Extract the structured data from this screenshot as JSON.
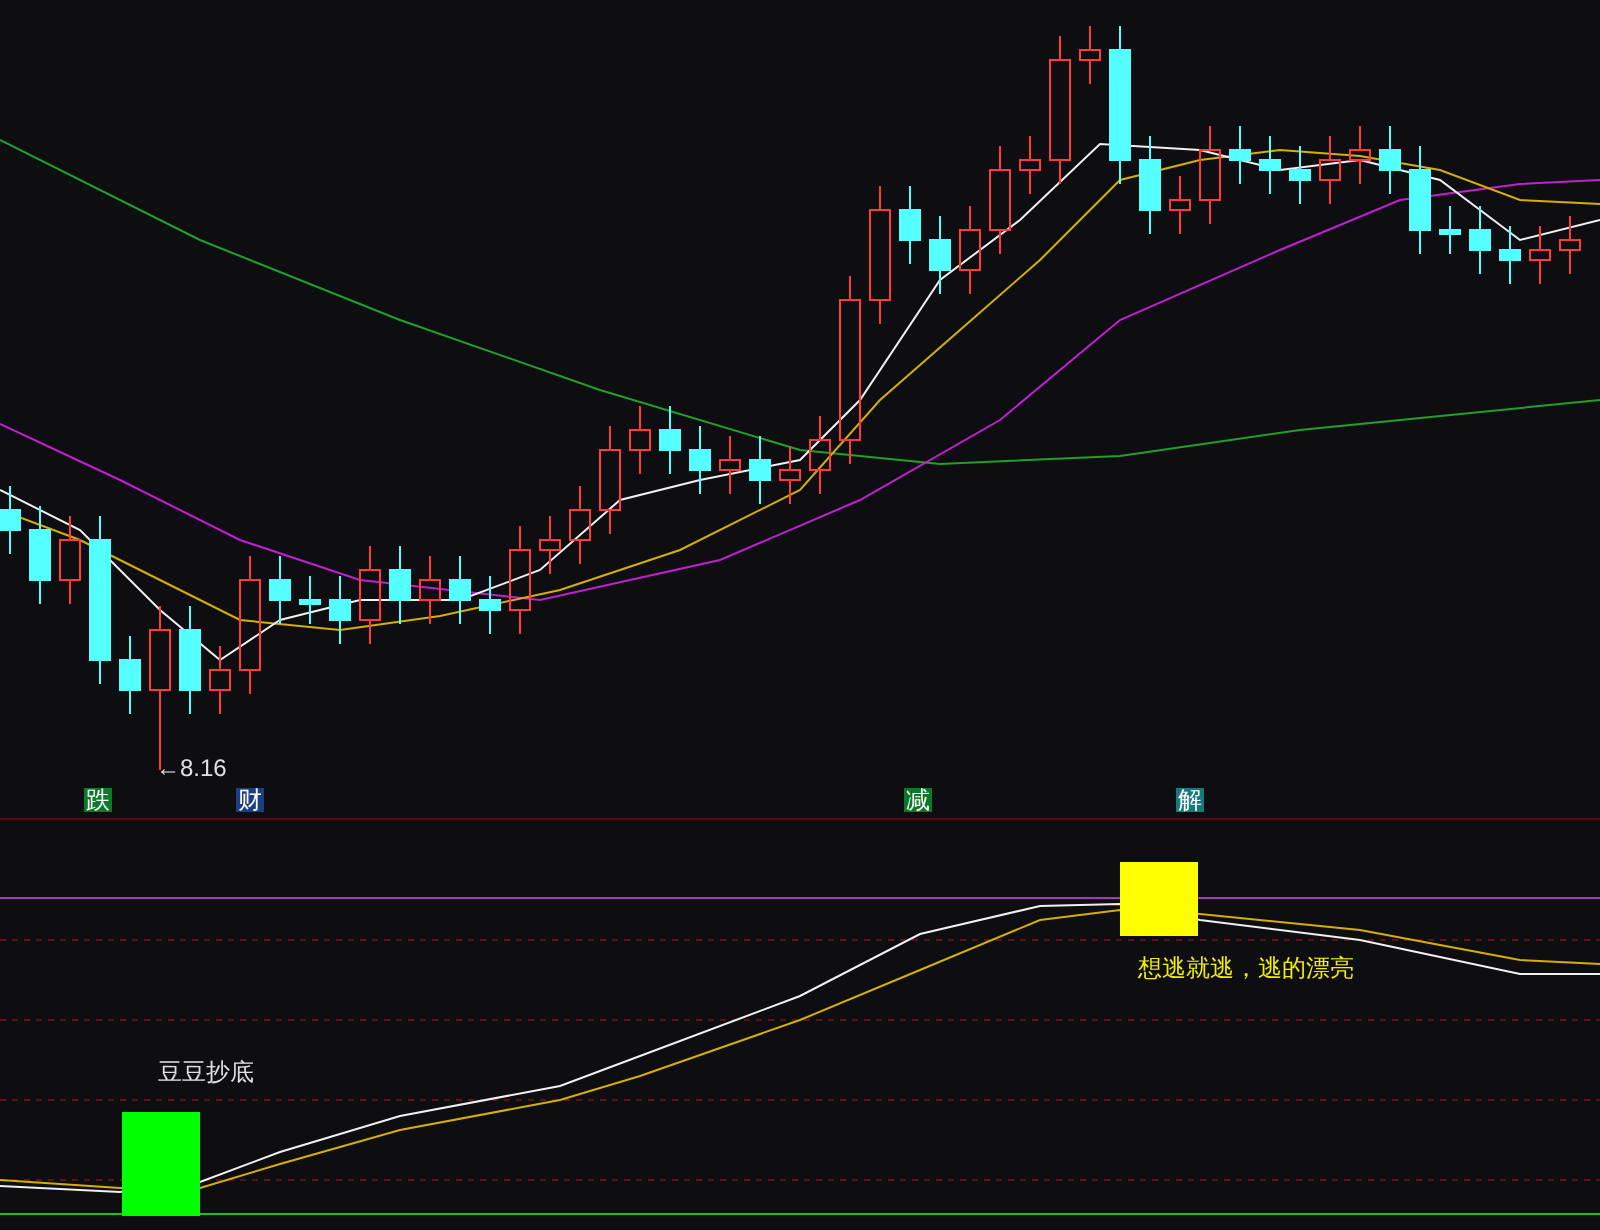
{
  "price_chart": {
    "low_label": "←8.16",
    "markers": [
      {
        "text": "跌",
        "color": "#0a7a28"
      },
      {
        "text": "财",
        "color": "#1a3f80"
      },
      {
        "text": "减",
        "color": "#0a7a28"
      },
      {
        "text": "解",
        "color": "#147a7a"
      }
    ]
  },
  "indicator": {
    "signals": [
      {
        "kind": "buy",
        "text": "豆豆抄底"
      },
      {
        "kind": "sell",
        "text": "想逃就逃，逃的漂亮"
      }
    ]
  }
}
